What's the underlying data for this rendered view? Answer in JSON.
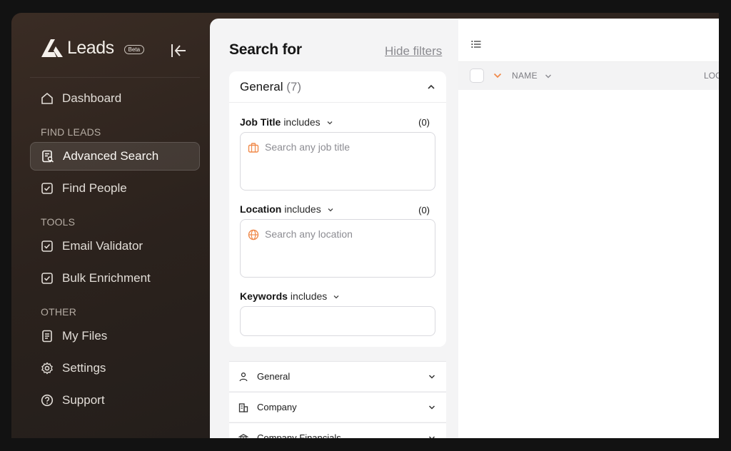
{
  "brand": {
    "name": "Leads",
    "badge": "Beta"
  },
  "sidebar": {
    "items": [
      {
        "label": "Dashboard"
      },
      {
        "label": "Advanced Search"
      },
      {
        "label": "Find People"
      },
      {
        "label": "Email Validator"
      },
      {
        "label": "Bulk Enrichment"
      },
      {
        "label": "My Files"
      },
      {
        "label": "Settings"
      },
      {
        "label": "Support"
      }
    ],
    "sections": {
      "find_leads": "FIND LEADS",
      "tools": "TOOLS",
      "other": "OTHER"
    }
  },
  "filters": {
    "title": "Search for",
    "hide_label": "Hide filters",
    "general_card": {
      "title": "General",
      "count": "(7)"
    },
    "job_title": {
      "label": "Job Title",
      "mode": "includes",
      "count": "(0)",
      "placeholder": "Search any job title"
    },
    "location": {
      "label": "Location",
      "mode": "includes",
      "count": "(0)",
      "placeholder": "Search any location"
    },
    "keywords": {
      "label": "Keywords",
      "mode": "includes"
    },
    "sections": [
      {
        "label": "General",
        "icon": "person-icon"
      },
      {
        "label": "Company",
        "icon": "building-icon"
      },
      {
        "label": "Company Financials",
        "icon": "bank-icon"
      }
    ]
  },
  "results": {
    "columns": {
      "name": "NAME",
      "location_partial": "LOC"
    }
  },
  "colors": {
    "accent": "#f08a4b",
    "sidebar_bg": "#2b221d",
    "panel_bg": "#f4f4f5"
  }
}
